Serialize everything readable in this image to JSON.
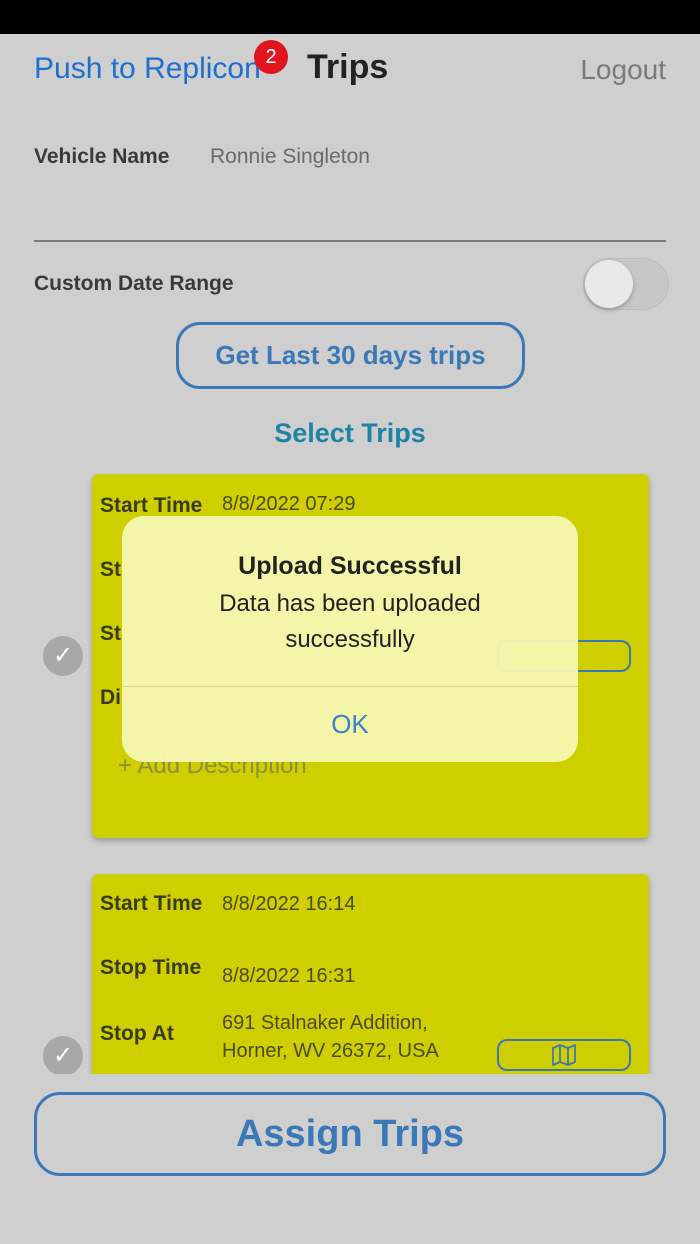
{
  "header": {
    "push_label": "Push to Replicon",
    "badge_count": "2",
    "title": "Trips",
    "logout_label": "Logout"
  },
  "form": {
    "vehicle_label": "Vehicle Name",
    "vehicle_value": "Ronnie Singleton",
    "custom_range_label": "Custom Date Range",
    "custom_range_enabled": false,
    "get_trips_label": "Get Last 30 days trips",
    "select_trips_label": "Select Trips"
  },
  "trips": [
    {
      "start_label": "Start Time",
      "start_value": "8/8/2022 07:29",
      "add_description": "+  Add Description"
    },
    {
      "start_label": "Start Time",
      "start_value": "8/8/2022 16:14",
      "stop_time_label": "Stop Time",
      "stop_time_value": "8/8/2022 16:31",
      "stop_at_label": "Stop At",
      "stop_at_value_line1": "691 Stalnaker Addition,",
      "stop_at_value_line2": "Horner, WV 26372, USA"
    }
  ],
  "assign_label": "Assign Trips",
  "dialog": {
    "title": "Upload Successful",
    "message": "Data has been uploaded successfully",
    "ok_label": "OK"
  },
  "colors": {
    "card": "#cfcf00",
    "accent": "#3a78b8",
    "badge": "#e0161f"
  }
}
